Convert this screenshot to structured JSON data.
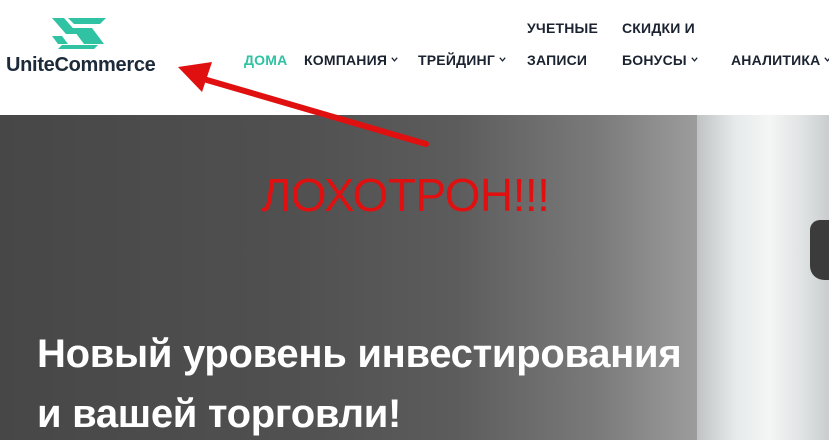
{
  "brand": {
    "name": "UniteCommerce",
    "logo_color": "#2fc2a3"
  },
  "nav": {
    "items": [
      {
        "label": "ДОМА",
        "active": true,
        "dropdown": false
      },
      {
        "label": "КОМПАНИЯ",
        "active": false,
        "dropdown": true
      },
      {
        "label": "ТРЕЙДИНГ",
        "active": false,
        "dropdown": true
      },
      {
        "label_line1": "УЧЕТНЫЕ",
        "label_line2": "ЗАПИСИ",
        "active": false,
        "dropdown": false
      },
      {
        "label_line1": "СКИДКИ И",
        "label_line2": "БОНУСЫ",
        "active": false,
        "dropdown": true
      },
      {
        "label": "АНАЛИТИКА",
        "active": false,
        "dropdown": true
      }
    ],
    "active_color": "#2fc2a3",
    "chevron_icon": "chevron-down-icon"
  },
  "annotation": {
    "text": "ЛОХОТРОН!!!",
    "color": "#e01010",
    "arrow_icon": "red-arrow"
  },
  "hero": {
    "title_line1": "Новый уровень инвестирования",
    "title_line2": "и вашей торговли!"
  }
}
